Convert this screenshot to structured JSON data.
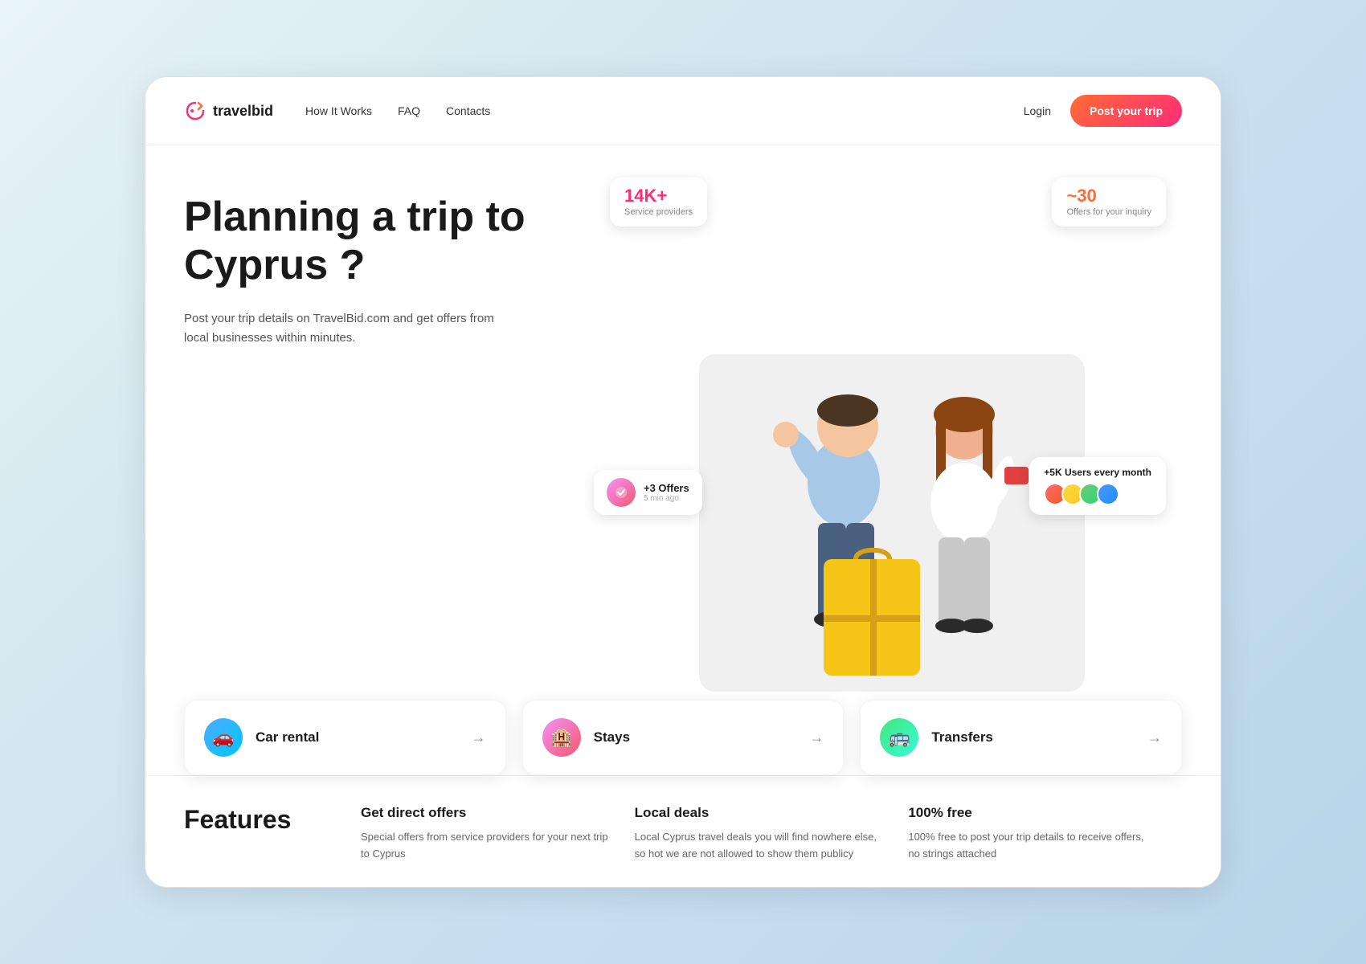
{
  "header": {
    "logo_text": "travelbid",
    "nav": [
      {
        "label": "How It Works"
      },
      {
        "label": "FAQ"
      },
      {
        "label": "Contacts"
      }
    ],
    "login_label": "Login",
    "post_trip_label": "Post your trip"
  },
  "hero": {
    "title": "Planning a trip to Cyprus ?",
    "subtitle": "Post your trip details on TravelBid.com and get offers from local businesses within minutes.",
    "stat1": {
      "number": "14K+",
      "label": "Service providers"
    },
    "stat2": {
      "number": "~30",
      "label": "Offers for your inquiry"
    },
    "stat3": {
      "main": "+3 Offers",
      "sub": "5 min ago"
    },
    "stat4": {
      "label": "+5K Users every month"
    }
  },
  "services": [
    {
      "label": "Car rental",
      "icon": "🚗",
      "color": "blue"
    },
    {
      "label": "Stays",
      "icon": "🏨",
      "color": "pink"
    },
    {
      "label": "Transfers",
      "icon": "🚌",
      "color": "green"
    }
  ],
  "features": {
    "section_title": "Features",
    "items": [
      {
        "title": "Get direct offers",
        "desc": "Special offers from service providers for your next trip to Cyprus"
      },
      {
        "title": "Local deals",
        "desc": "Local Cyprus travel deals you will find nowhere else, so hot we are not allowed to show them publicy"
      },
      {
        "title": "100% free",
        "desc": "100% free to post your trip details to receive offers, no strings attached"
      }
    ]
  }
}
